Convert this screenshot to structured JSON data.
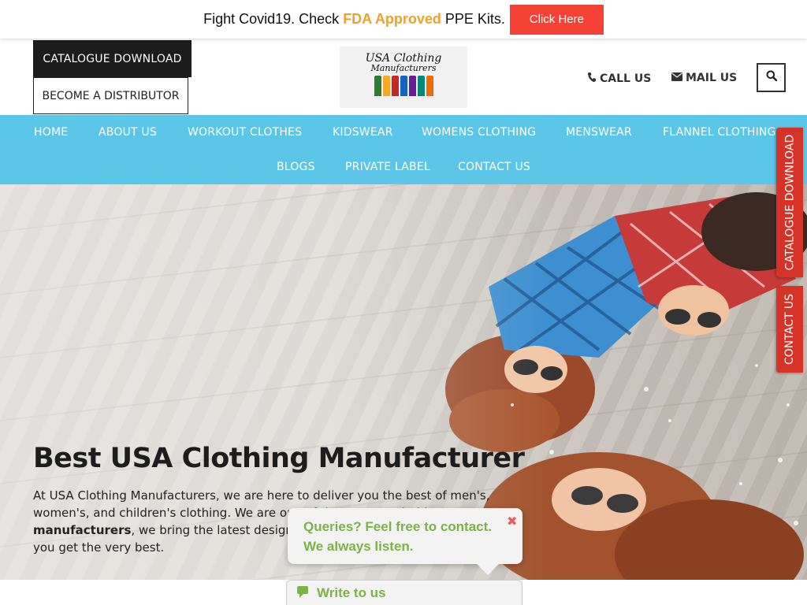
{
  "promo": {
    "text_before": "Fight Covid19. Check ",
    "highlight": "FDA Approved",
    "text_after": " PPE Kits.",
    "button": "Click Here",
    "highlight_color": "#f0a12a",
    "button_color": "#f44336"
  },
  "header": {
    "catalogue_button": "CATALOGUE DOWNLOAD",
    "distributor_button": "BECOME A DISTRIBUTOR",
    "logo_line1": "USA Clothing",
    "logo_line2": "Manufacturers",
    "call": "CALL US",
    "mail": "MAIL US",
    "search_icon": "search-icon"
  },
  "nav": {
    "color": "#5bc6e8",
    "items": [
      "HOME",
      "ABOUT US",
      "WORKOUT CLOTHES",
      "KIDSWEAR",
      "WOMENS CLOTHING",
      "MENSWEAR",
      "FLANNEL CLOTHING",
      "BLOGS",
      "PRIVATE LABEL",
      "CONTACT US"
    ]
  },
  "hero": {
    "title": "Best USA Clothing Manufacturer",
    "para_1": "At USA Clothing Manufacturers, we are here to deliver you the best of men's,",
    "para_2": "women's, and children's clothing. We are one of the top USA clothing",
    "para_bold": "manufacturers",
    "para_3": ", we bring the latest designs, fabrics and",
    "para_4": "you get the very best."
  },
  "side_tabs": {
    "catalogue": "CATALOGUE DOWNLOAD",
    "contact": "CONTACT US",
    "color": "#d63228"
  },
  "chat": {
    "message": "Queries? Feel free to contact. We always listen.",
    "bar_label": "Write to us",
    "close_icon": "close-icon",
    "chat_icon": "chat-icon",
    "accent": "#7cb342"
  }
}
